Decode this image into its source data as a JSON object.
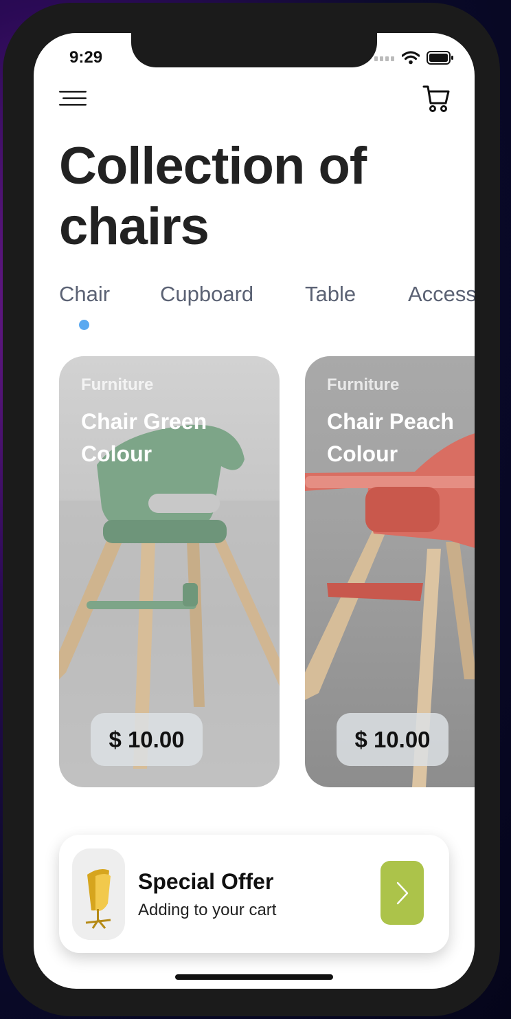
{
  "status_bar": {
    "time": "9:29",
    "signal_icon": "signal-icon",
    "wifi_icon": "wifi-icon",
    "battery_icon": "battery-icon"
  },
  "header": {
    "menu_icon": "menu-icon",
    "cart_icon": "cart-icon",
    "title": "Collection of chairs"
  },
  "tabs": [
    {
      "label": "Chair",
      "selected": true
    },
    {
      "label": "Cupboard",
      "selected": false
    },
    {
      "label": "Table",
      "selected": false
    },
    {
      "label": "Access",
      "selected": false
    }
  ],
  "products": [
    {
      "category": "Furniture",
      "name": "Chair Green Colour",
      "price": "$ 10.00",
      "chair_color": "#7da588"
    },
    {
      "category": "Furniture",
      "name": "Chair Peach Colour",
      "price": "$ 10.00",
      "chair_color": "#d96e62"
    }
  ],
  "offer": {
    "title": "Special Offer",
    "subtitle": "Adding to your cart",
    "button_icon": "chevron-right-icon",
    "thumb_icon": "gold-chair-icon"
  },
  "colors": {
    "accent": "#5aa9f0",
    "offer_button": "#acc34a",
    "frame": "#1b1b1b"
  }
}
